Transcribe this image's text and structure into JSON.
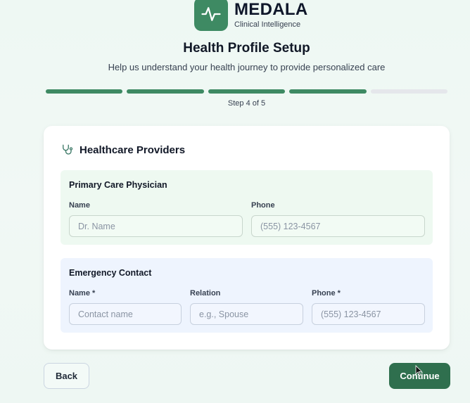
{
  "brand": {
    "name": "MEDALA",
    "tagline": "Clinical Intelligence",
    "logo_icon": "activity-pulse-icon",
    "color": "#3e8a63"
  },
  "page": {
    "title": "Health Profile Setup",
    "subtitle": "Help us understand your health journey to provide personalized care"
  },
  "progress": {
    "current_step": 4,
    "total_steps": 5,
    "label": "Step 4 of 5",
    "done_color": "#3e8a63",
    "todo_color": "#e5e7eb"
  },
  "card": {
    "title": "Healthcare Providers",
    "icon": "stethoscope-icon",
    "primary_care": {
      "title": "Primary Care Physician",
      "name_label": "Name",
      "name_placeholder": "Dr. Name",
      "name_value": "",
      "phone_label": "Phone",
      "phone_placeholder": "(555) 123-4567",
      "phone_value": ""
    },
    "emergency": {
      "title": "Emergency Contact",
      "name_label": "Name *",
      "name_placeholder": "Contact name",
      "name_value": "",
      "relation_label": "Relation",
      "relation_placeholder": "e.g., Spouse",
      "relation_value": "",
      "phone_label": "Phone *",
      "phone_placeholder": "(555) 123-4567",
      "phone_value": ""
    }
  },
  "actions": {
    "back_label": "Back",
    "continue_label": "Continue",
    "continue_color": "#2f6f4e"
  }
}
